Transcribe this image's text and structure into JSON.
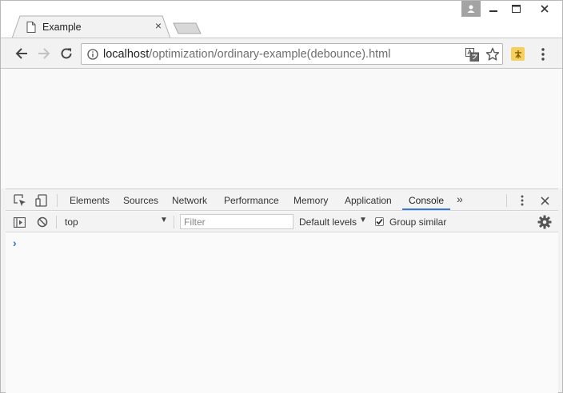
{
  "browser": {
    "tab": {
      "title": "Example",
      "icon": "page-icon",
      "close": "×"
    },
    "url": {
      "host": "localhost",
      "path": "/optimization/ordinary-example(debounce).html"
    }
  },
  "devtools": {
    "tabs": [
      {
        "label": "Elements"
      },
      {
        "label": "Sources"
      },
      {
        "label": "Network"
      },
      {
        "label": "Performance"
      },
      {
        "label": "Memory"
      },
      {
        "label": "Application"
      },
      {
        "label": "Console",
        "active": true
      }
    ],
    "more": "»",
    "console": {
      "context": "top",
      "filter_placeholder": "Filter",
      "levels": "Default levels",
      "group_similar": "Group similar",
      "group_similar_checked": true,
      "prompt": "›"
    }
  },
  "colors": {
    "accent": "#3879d9",
    "prompt": "#2e75d6",
    "extension": "#f6d05c"
  }
}
